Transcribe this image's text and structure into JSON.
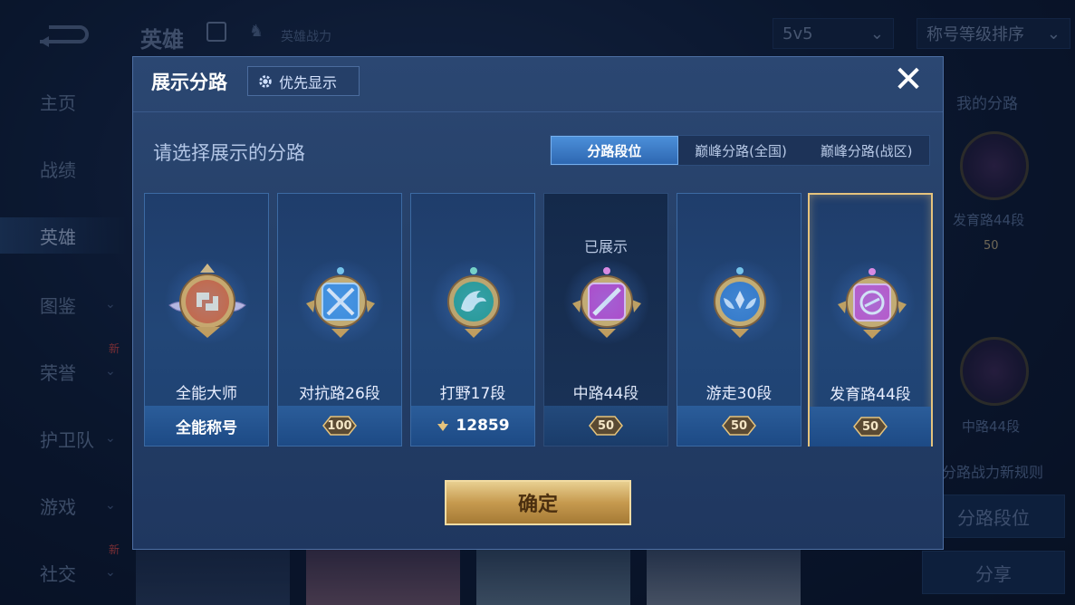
{
  "background": {
    "top_title": "英雄",
    "top_subtitle": "英雄战力",
    "mode_select": "5v5",
    "sort_select": "称号等级排序",
    "sidebar": [
      {
        "label": "主页",
        "chevron": false,
        "new": false
      },
      {
        "label": "战绩",
        "chevron": false,
        "new": false
      },
      {
        "label": "英雄",
        "chevron": false,
        "new": false,
        "active": true
      },
      {
        "label": "图鉴",
        "chevron": true,
        "new": false
      },
      {
        "label": "荣誉",
        "chevron": true,
        "new": true
      },
      {
        "label": "护卫队",
        "chevron": true,
        "new": false
      },
      {
        "label": "游戏",
        "chevron": true,
        "new": false
      },
      {
        "label": "社交",
        "chevron": true,
        "new": true
      }
    ],
    "new_badge": "新",
    "right_panel": {
      "heading": "我的分路",
      "route1_label": "发育路44段",
      "route1_level": "50",
      "route2_label": "中路44段",
      "rule_text": "分路战力新规则",
      "rank_button": "分路段位",
      "share_button": "分享"
    }
  },
  "modal": {
    "title": "展示分路",
    "pref_button": "优先显示",
    "instruction": "请选择展示的分路",
    "tabs": [
      {
        "label": "分路段位",
        "active": true
      },
      {
        "label": "巅峰分路(全国)",
        "active": false
      },
      {
        "label": "巅峰分路(战区)",
        "active": false
      }
    ],
    "cards": [
      {
        "label": "全能大师",
        "footer_text": "全能称号",
        "icon": "all-round-master-emblem",
        "state": "normal"
      },
      {
        "label": "对抗路26段",
        "level": "100",
        "icon": "clash-lane-emblem",
        "state": "normal"
      },
      {
        "label": "打野17段",
        "power": "12859",
        "icon": "jungle-emblem",
        "state": "normal"
      },
      {
        "label": "中路44段",
        "level": "50",
        "icon": "mid-lane-emblem",
        "state": "shown",
        "shown_text": "已展示"
      },
      {
        "label": "游走30段",
        "level": "50",
        "icon": "roam-emblem",
        "state": "normal"
      },
      {
        "label": "发育路44段",
        "level": "50",
        "icon": "farm-lane-emblem",
        "state": "selected"
      }
    ],
    "confirm": "确定"
  },
  "colors": {
    "accent_blue": "#2d67b1",
    "gold": "#e5c37d",
    "mid_purple": "#c43fc9",
    "farm_pink": "#d04fc8",
    "clash_blue": "#3a8fe0",
    "jungle_teal": "#1fa08a",
    "roam_blue": "#2f78c8",
    "all_orange": "#e0622a"
  }
}
